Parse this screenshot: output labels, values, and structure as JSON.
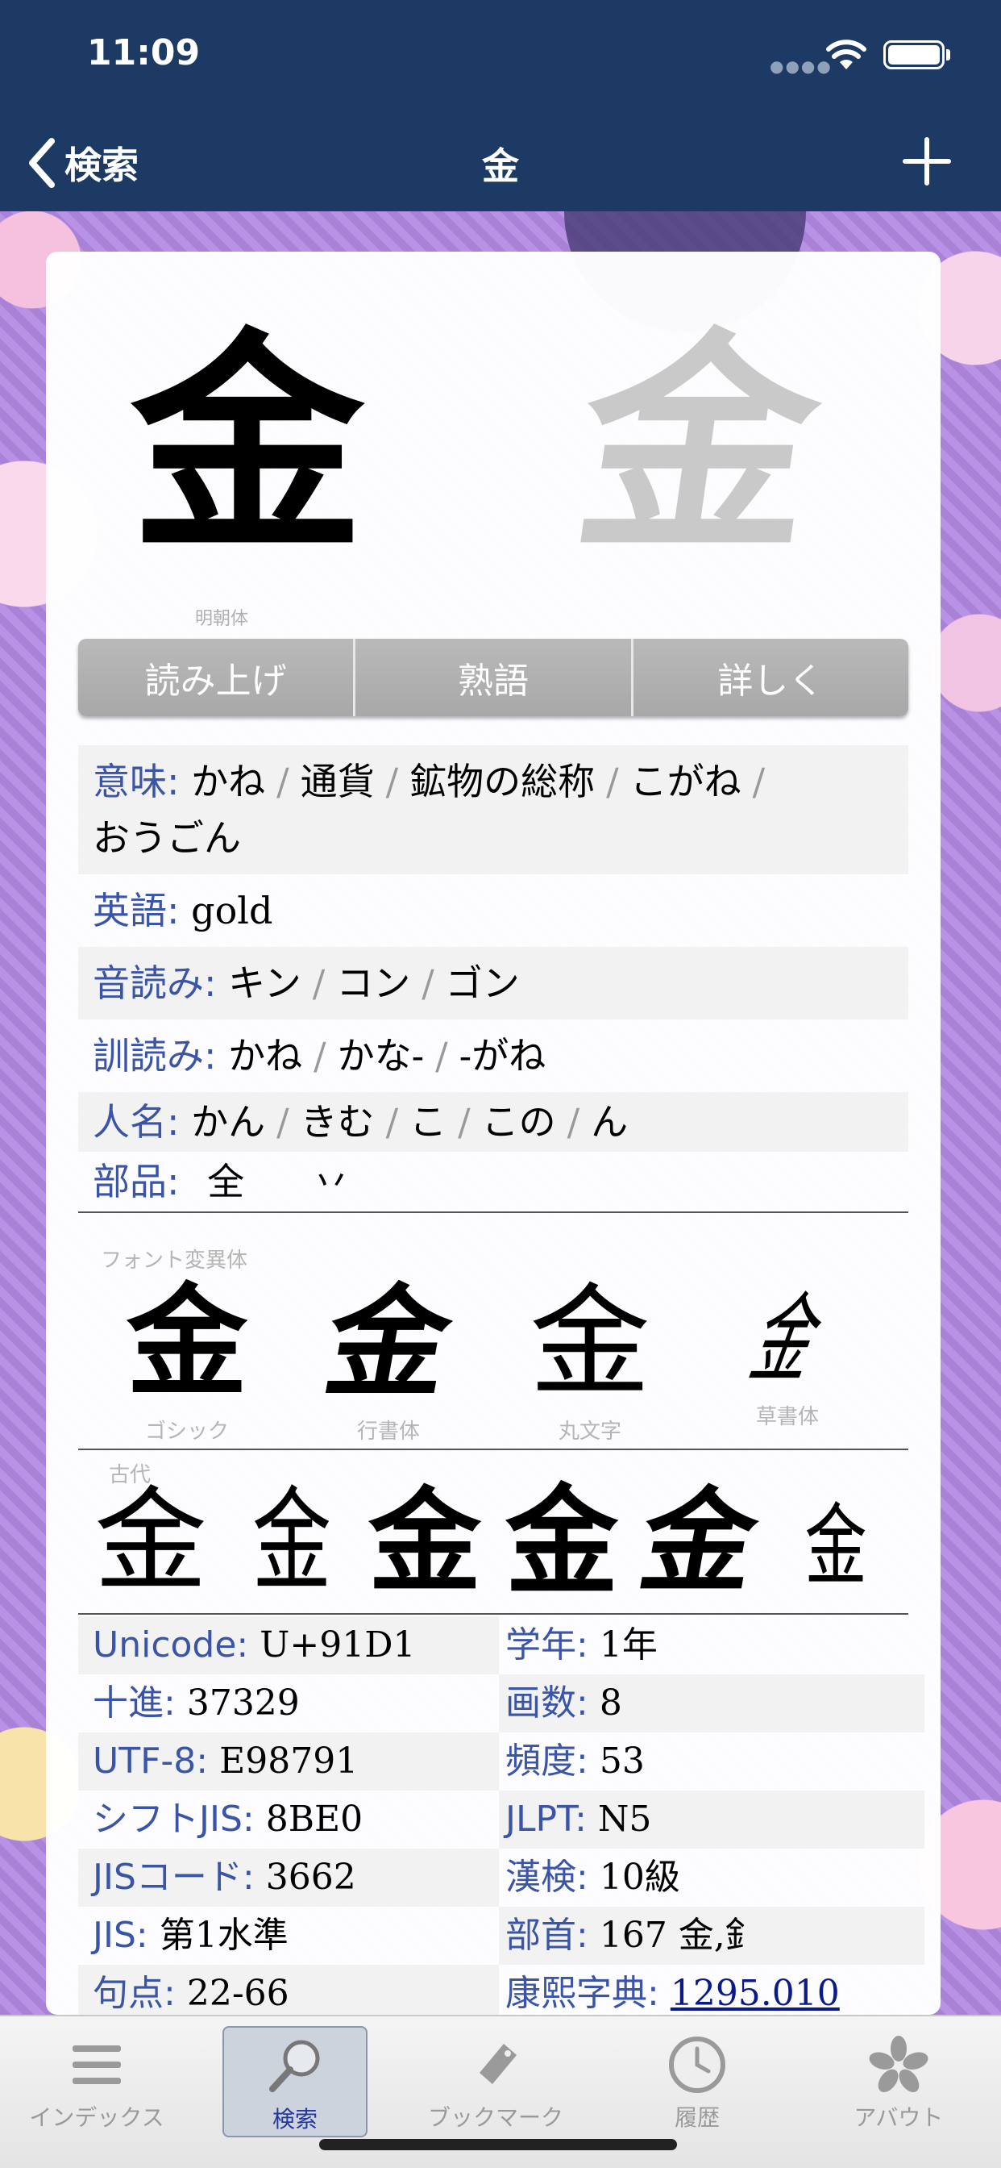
{
  "status_bar": {
    "time": "11:09"
  },
  "nav": {
    "back_label": "検索",
    "title": "金"
  },
  "glyph": {
    "main": "金",
    "mincho_caption": "明朝体"
  },
  "actions": [
    "読み上げ",
    "熟語",
    "詳しく"
  ],
  "info": {
    "meaning_label": "意味:",
    "meanings": [
      "かね",
      "通貨",
      "鉱物の総称",
      "こがね",
      "おうごん"
    ],
    "english_label": "英語:",
    "english": "gold",
    "on_label": "音読み:",
    "on_readings": [
      "キン",
      "コン",
      "ゴン"
    ],
    "kun_label": "訓読み:",
    "kun_readings": [
      "かね",
      "かな-",
      "-がね"
    ],
    "name_label": "人名:",
    "name_readings": [
      "かん",
      "きむ",
      "こ",
      "この",
      "ん"
    ],
    "parts_label": "部品:",
    "parts": [
      "全",
      "丷"
    ]
  },
  "variants": {
    "caption": "フォント変異体",
    "items": [
      {
        "glyph": "金",
        "caption": "ゴシック"
      },
      {
        "glyph": "金",
        "caption": "行書体"
      },
      {
        "glyph": "金",
        "caption": "丸文字"
      },
      {
        "glyph": "金",
        "caption": "草書体"
      }
    ]
  },
  "ancient": {
    "caption": "古代",
    "glyphs": [
      "金",
      "金",
      "金",
      "金",
      "金",
      "金"
    ]
  },
  "codes": {
    "left": [
      {
        "label": "Unicode:",
        "value": "U+91D1"
      },
      {
        "label": "十進:",
        "value": "37329"
      },
      {
        "label": "UTF-8:",
        "value": "E98791"
      },
      {
        "label": "シフトJIS:",
        "value": "8BE0"
      },
      {
        "label": "JISコード:",
        "value": "3662"
      },
      {
        "label": "JIS:",
        "value": "第1水準"
      },
      {
        "label": "句点:",
        "value": "22-66"
      }
    ],
    "right": [
      {
        "label": "学年:",
        "value": "1年"
      },
      {
        "label": "画数:",
        "value": "8"
      },
      {
        "label": "頻度:",
        "value": "53"
      },
      {
        "label": "JLPT:",
        "value": "N5"
      },
      {
        "label": "漢検:",
        "value": "10級"
      },
      {
        "label": "部首:",
        "value": "167 金,釒"
      },
      {
        "label": "康熙字典:",
        "value": "1295.010"
      }
    ]
  },
  "tabs": [
    {
      "label": "インデックス",
      "icon": "list-icon"
    },
    {
      "label": "検索",
      "icon": "magnifier-icon"
    },
    {
      "label": "ブックマーク",
      "icon": "bookmark-tag-icon"
    },
    {
      "label": "履歴",
      "icon": "clock-icon"
    },
    {
      "label": "アバウト",
      "icon": "sakura-icon"
    }
  ]
}
